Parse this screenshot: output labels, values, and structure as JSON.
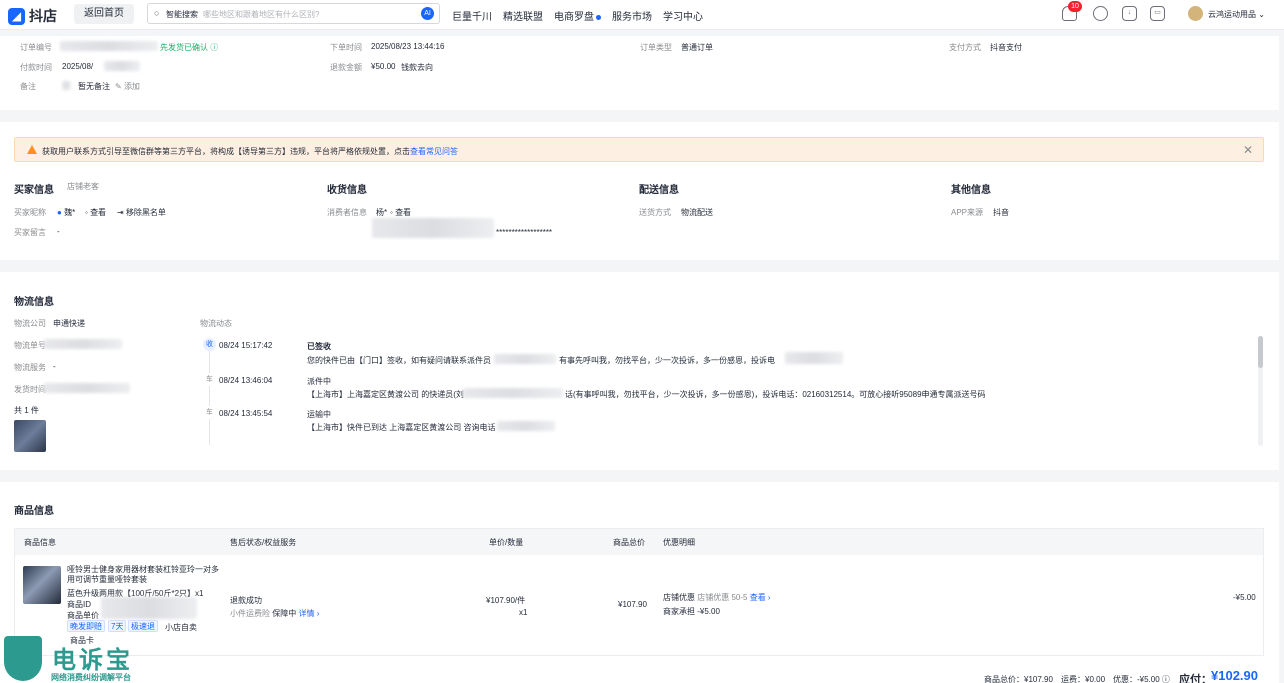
{
  "topbar": {
    "logo_text": "抖店",
    "home_button": "返回首页",
    "search_label": "智能搜索",
    "search_placeholder": "哪些地区和跟着地区有什么区别?",
    "nav": [
      "巨量千川",
      "精选联盟",
      "电商罗盘",
      "服务市场",
      "学习中心"
    ],
    "notification_count": "10",
    "shop_name": "云鸿运动用品"
  },
  "order": {
    "order_no_label": "订单编号",
    "order_status": "先发货已确认",
    "pay_time_label": "付款时间",
    "pay_time_value": "2025/08/",
    "remark_label": "备注",
    "remark_value": "暂无备注",
    "remark_add": "添加",
    "order_time_label": "下单时间",
    "order_time_value": "2025/08/23 13:44:16",
    "refund_amount_label": "退款金额",
    "refund_amount_value": "¥50.00",
    "refund_link": "钱款去向",
    "order_type_label": "订单类型",
    "order_type_value": "普通订单",
    "pay_method_label": "支付方式",
    "pay_method_value": "抖音支付"
  },
  "alert": {
    "text": "获取用户联系方式引导至微信群等第三方平台，将构成【诱导第三方】违规，平台将严格依规处置，点击",
    "link": "查看常见问答"
  },
  "info": {
    "buyer_title": "买家信息",
    "buyer_tag": "店铺老客",
    "buyer_nick_label": "买家昵称",
    "buyer_nick_value": "魏*",
    "buyer_view": "查看",
    "buyer_blacklist": "移除黑名单",
    "buyer_msg_label": "买家留言",
    "buyer_msg_value": "-",
    "receiver_title": "收货信息",
    "consumer_label": "消费者信息",
    "consumer_value": "杨*",
    "consumer_view": "查看",
    "consumer_masked": "******************",
    "delivery_title": "配送信息",
    "delivery_method_label": "送货方式",
    "delivery_method_value": "物流配送",
    "other_title": "其他信息",
    "app_label": "APP来源",
    "app_value": "抖音"
  },
  "logistics": {
    "title": "物流信息",
    "company_label": "物流公司",
    "company_value": "申通快递",
    "tracking_label": "物流单号",
    "service_label": "物流服务",
    "service_value": "-",
    "ship_time_label": "发货时间",
    "count": "共 1 件",
    "dynamics_label": "物流动态",
    "events": [
      {
        "time": "08/24 15:17:42",
        "status": "已签收",
        "detail": "您的快件已由【门口】签收，如有疑问请联系派件员",
        "detail_tail": "有事先呼叫我，勿找平台，少一次投诉，多一份感恩，投诉电",
        "icon": "收"
      },
      {
        "time": "08/24 13:46:04",
        "status": "派件中",
        "detail": "【上海市】上海嘉定区黄渡公司 的快递员(刘",
        "detail_tail": "话(有事呼叫我，勿找平台，少一次投诉，多一份感恩)，投诉电话：02160312514。可放心接听95089申通专属派送号码",
        "icon": "车"
      },
      {
        "time": "08/24 13:45:54",
        "status": "运输中",
        "detail": "【上海市】快件已到达 上海嘉定区黄渡公司 咨询电话",
        "detail_tail": "",
        "icon": "车"
      }
    ]
  },
  "goods": {
    "title": "商品信息",
    "headers": [
      "商品信息",
      "售后状态/权益服务",
      "单价/数量",
      "商品总价",
      "优惠明细"
    ],
    "product_name": "哑铃男士健身家用器材套装杠铃亚玲一对多用可调节重量哑铃套装",
    "product_spec": "蓝色升级两用款【100斤/50斤*2只】x1",
    "product_code_label": "商品ID",
    "product_code_label2": "商品单价",
    "tags": [
      "晚发即赔",
      "7天",
      "极速退"
    ],
    "tag_plain": "小店自卖",
    "card_label": "商品卡",
    "after_sale_status": "退款成功",
    "insurance_label": "小件运费险",
    "insurance_state": "保障中",
    "insurance_link": "详情",
    "unit_price": "¥107.90/件",
    "qty": "x1",
    "total": "¥107.90",
    "discount_name": "店铺优惠",
    "discount_desc": "店铺优惠 50-5",
    "discount_link": "查看",
    "discount_sub": "商家承担 -¥5.00",
    "discount_amount": "-¥5.00"
  },
  "summary": {
    "goods_total_label": "商品总价：¥107.90",
    "freight_label": "运费：¥0.00",
    "discount_label": "优惠：-¥5.00",
    "payable_label": "应付：",
    "payable_value": "¥102.90"
  },
  "watermark": {
    "title": "电诉宝",
    "sub": "网络消费纠纷调解平台"
  }
}
